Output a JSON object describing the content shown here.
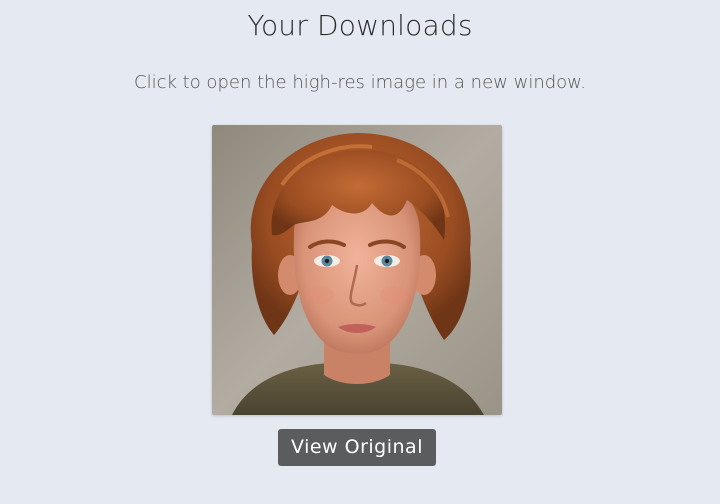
{
  "page": {
    "title": "Your Downloads",
    "subtitle": "Click to open the high-res image in a new window."
  },
  "download": {
    "image_alt": "Portrait of a young man with wavy auburn hair and blue eyes",
    "button_label": "View Original"
  },
  "colors": {
    "background": "#e5e9f1",
    "button": "#5a5c5e",
    "button_text": "#ffffff"
  }
}
